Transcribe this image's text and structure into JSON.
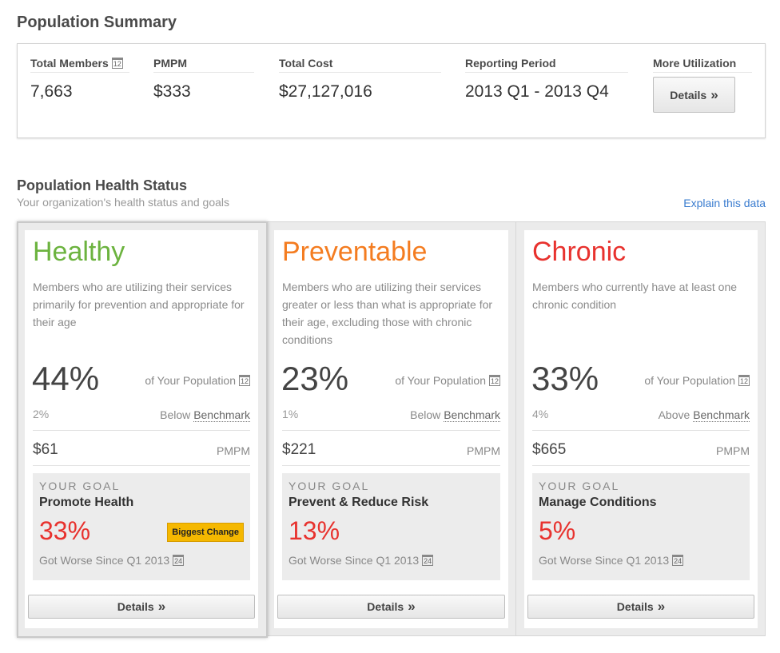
{
  "summary": {
    "title": "Population Summary",
    "metrics": [
      {
        "label": "Total Members",
        "value": "7,663",
        "icon": "calendar-icon",
        "icon_text": "12"
      },
      {
        "label": "PMPM",
        "value": "$333"
      },
      {
        "label": "Total Cost",
        "value": "$27,127,016"
      },
      {
        "label": "Reporting Period",
        "value": "2013 Q1 - 2013 Q4"
      },
      {
        "label": "More Utilization"
      }
    ],
    "details_label": "Details"
  },
  "health": {
    "title": "Population Health Status",
    "subtitle": "Your organization's health status and goals",
    "explain_link": "Explain this data",
    "calendar_pop": "12",
    "calendar_goal": "24",
    "cards": [
      {
        "title": "Healthy",
        "color": "#6cb33f",
        "desc": "Members who are utilizing their services primarily for prevention and appropriate for their age",
        "pct": "44%",
        "pop_label": "of Your Population",
        "bench_val": "2%",
        "bench_dir": "Below",
        "bench_word": "Benchmark",
        "pmpm_val": "$61",
        "pmpm_label": "PMPM",
        "goal_label": "YOUR GOAL",
        "goal_name": "Promote Health",
        "goal_pct": "33%",
        "goal_status": "Got Worse Since Q1 2013",
        "badge": "Biggest Change",
        "details": "Details"
      },
      {
        "title": "Preventable",
        "color": "#f47c20",
        "desc": "Members who are utilizing their services greater or less than what is appropriate for their age, excluding those with chronic conditions",
        "pct": "23%",
        "pop_label": "of Your Population",
        "bench_val": "1%",
        "bench_dir": "Below",
        "bench_word": "Benchmark",
        "pmpm_val": "$221",
        "pmpm_label": "PMPM",
        "goal_label": "YOUR GOAL",
        "goal_name": "Prevent & Reduce Risk",
        "goal_pct": "13%",
        "goal_status": "Got Worse Since Q1 2013",
        "details": "Details"
      },
      {
        "title": "Chronic",
        "color": "#e8322e",
        "desc": "Members who currently have at least one chronic condition",
        "pct": "33%",
        "pop_label": "of Your Population",
        "bench_val": "4%",
        "bench_dir": "Above",
        "bench_word": "Benchmark",
        "pmpm_val": "$665",
        "pmpm_label": "PMPM",
        "goal_label": "YOUR GOAL",
        "goal_name": "Manage Conditions",
        "goal_pct": "5%",
        "goal_status": "Got Worse Since Q1 2013",
        "details": "Details"
      }
    ]
  }
}
